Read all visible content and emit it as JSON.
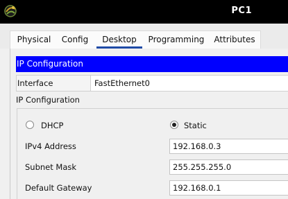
{
  "window": {
    "title": "PC1"
  },
  "tabs": [
    {
      "label": "Physical"
    },
    {
      "label": "Config"
    },
    {
      "label": "Desktop",
      "active": true
    },
    {
      "label": "Programming"
    },
    {
      "label": "Attributes"
    }
  ],
  "panel": {
    "header": "IP Configuration",
    "interface": {
      "label": "Interface",
      "value": "FastEthernet0"
    },
    "ip_config_label": "IP Configuration",
    "mode": {
      "dhcp_label": "DHCP",
      "static_label": "Static",
      "selected": "Static"
    },
    "fields": {
      "ipv4": {
        "label": "IPv4 Address",
        "value": "192.168.0.3"
      },
      "subnet": {
        "label": "Subnet Mask",
        "value": "255.255.255.0"
      },
      "gateway": {
        "label": "Default Gateway",
        "value": "192.168.0.1"
      }
    }
  },
  "colors": {
    "header_bg": "#0000ff",
    "tab_underline": "#1f4aa6",
    "titlebar_bg": "#000000"
  },
  "icons": {
    "app": "cisco-packet-tracer-logo-icon"
  }
}
